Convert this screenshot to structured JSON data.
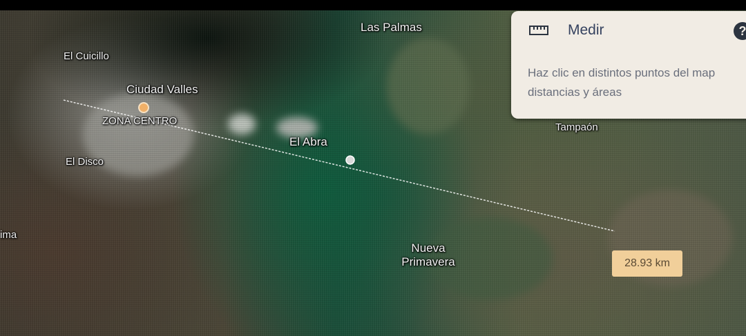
{
  "map": {
    "places": {
      "las_palmas": "Las Palmas",
      "el_cuicillo": "El Cuicillo",
      "ciudad_valles": "Ciudad Valles",
      "zona_centro": "ZONA CENTRO",
      "el_abra": "El Abra",
      "el_disco": "El Disco",
      "tampaon": "Tampaón",
      "nueva_primavera": "Nueva\nPrimavera",
      "ima": "ima"
    }
  },
  "measure_panel": {
    "title": "Medir",
    "ruler_icon": "ruler-icon",
    "help_icon": "help-icon",
    "help_glyph": "?",
    "line1": "Haz clic en distintos puntos del map",
    "line2": "distancias y áreas"
  },
  "distance_label": "28.93 km",
  "colors": {
    "panel_bg": "#f1ece4",
    "distance_bg": "#f1cf9a",
    "measure_line": "#ffffff"
  }
}
